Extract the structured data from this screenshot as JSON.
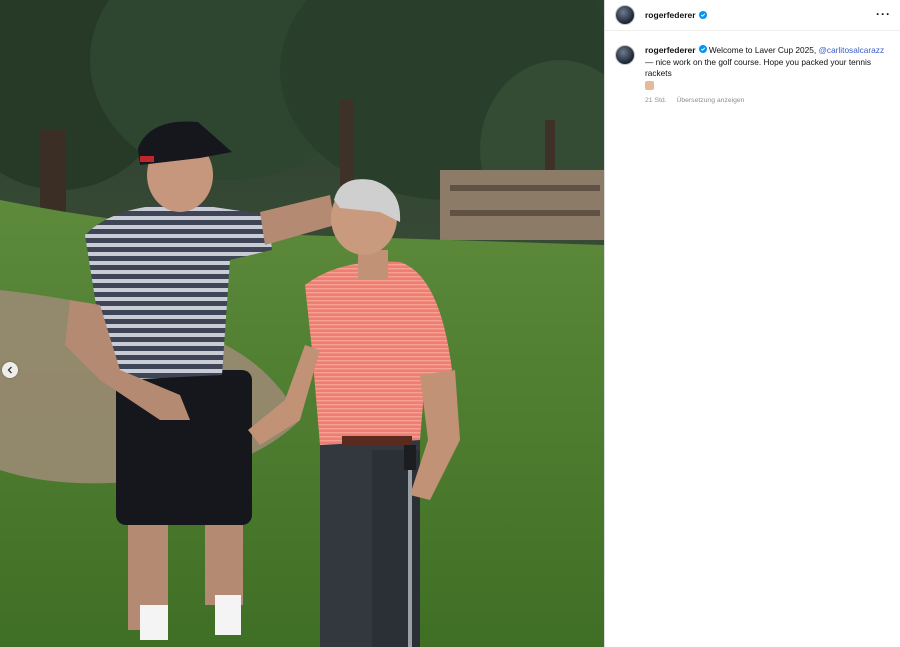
{
  "post": {
    "username": "rogerfederer",
    "more_icon": "more-horizontal-icon",
    "caption_part1": "Welcome to Laver Cup 2025, ",
    "mention": "@carlitosalcarazz",
    "caption_part2": " — nice work on the golf course. Hope you packed your tennis rackets",
    "emoji": "folded-hands-emoji",
    "time": "21 Std.",
    "translate_label": "Übersetzung anzeigen"
  },
  "colors": {
    "verified": "#0095f6",
    "mention": "#385cc9",
    "meta": "#8e8e8e"
  }
}
